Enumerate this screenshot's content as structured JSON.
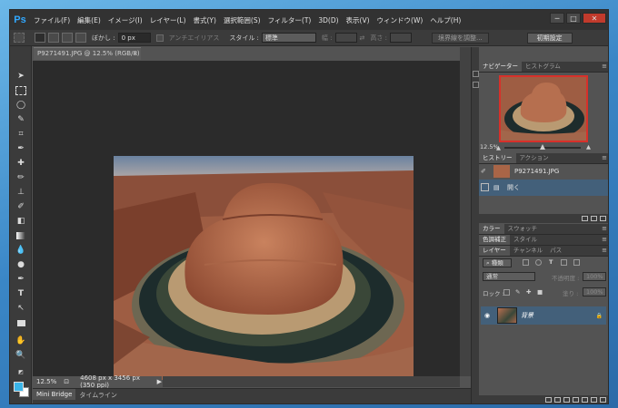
{
  "app": {
    "logo": "Ps"
  },
  "menu": [
    "ファイル(F)",
    "編集(E)",
    "イメージ(I)",
    "レイヤー(L)",
    "書式(Y)",
    "選択範囲(S)",
    "フィルター(T)",
    "3D(D)",
    "表示(V)",
    "ウィンドウ(W)",
    "ヘルプ(H)"
  ],
  "window_controls": {
    "minimize": "─",
    "maximize": "□",
    "close": "✕"
  },
  "options": {
    "feather_label": "ぼかし :",
    "feather_value": "0 px",
    "antialias_label": "アンチエイリアス",
    "style_label": "スタイル :",
    "style_value": "標準",
    "width_label": "幅 :",
    "height_label": "高さ :",
    "refine_edge": "境界線を調整...",
    "workspace": "初期設定"
  },
  "document": {
    "tab_title": "P9271491.JPG @ 12.5% (RGB/8)",
    "zoom": "12.5%",
    "doc_info": "4608 px x 3456 px (350 ppi)"
  },
  "bottom_tabs": [
    "Mini Bridge",
    "タイムライン"
  ],
  "panels": {
    "navigator_tabs": [
      "ナビゲーター",
      "ヒストグラム"
    ],
    "navigator_zoom": "12.5%",
    "navigator_zoom_level": 0.5,
    "history_tabs": [
      "ヒストリー",
      "アクション"
    ],
    "history_items": [
      {
        "label": "P9271491.JPG"
      },
      {
        "label": "開く"
      }
    ],
    "color_tabs": [
      "カラー",
      "スウォッチ"
    ],
    "adjust_tabs": [
      "色調補正",
      "スタイル"
    ],
    "layer_tabs": [
      "レイヤー",
      "チャンネル",
      "パス"
    ],
    "layer_kind": "種類",
    "blend_mode": "通常",
    "opacity_label": "不透明度 :",
    "opacity_value": "100%",
    "lock_label": "ロック :",
    "fill_label": "塗り :",
    "fill_value": "100%",
    "layer_name": "背景",
    "lock_glyph": "🔒"
  },
  "colors": {
    "foreground": "#3ab5e9",
    "background": "#ffffff",
    "accent": "#31a8ff",
    "selection": "#43607a"
  }
}
